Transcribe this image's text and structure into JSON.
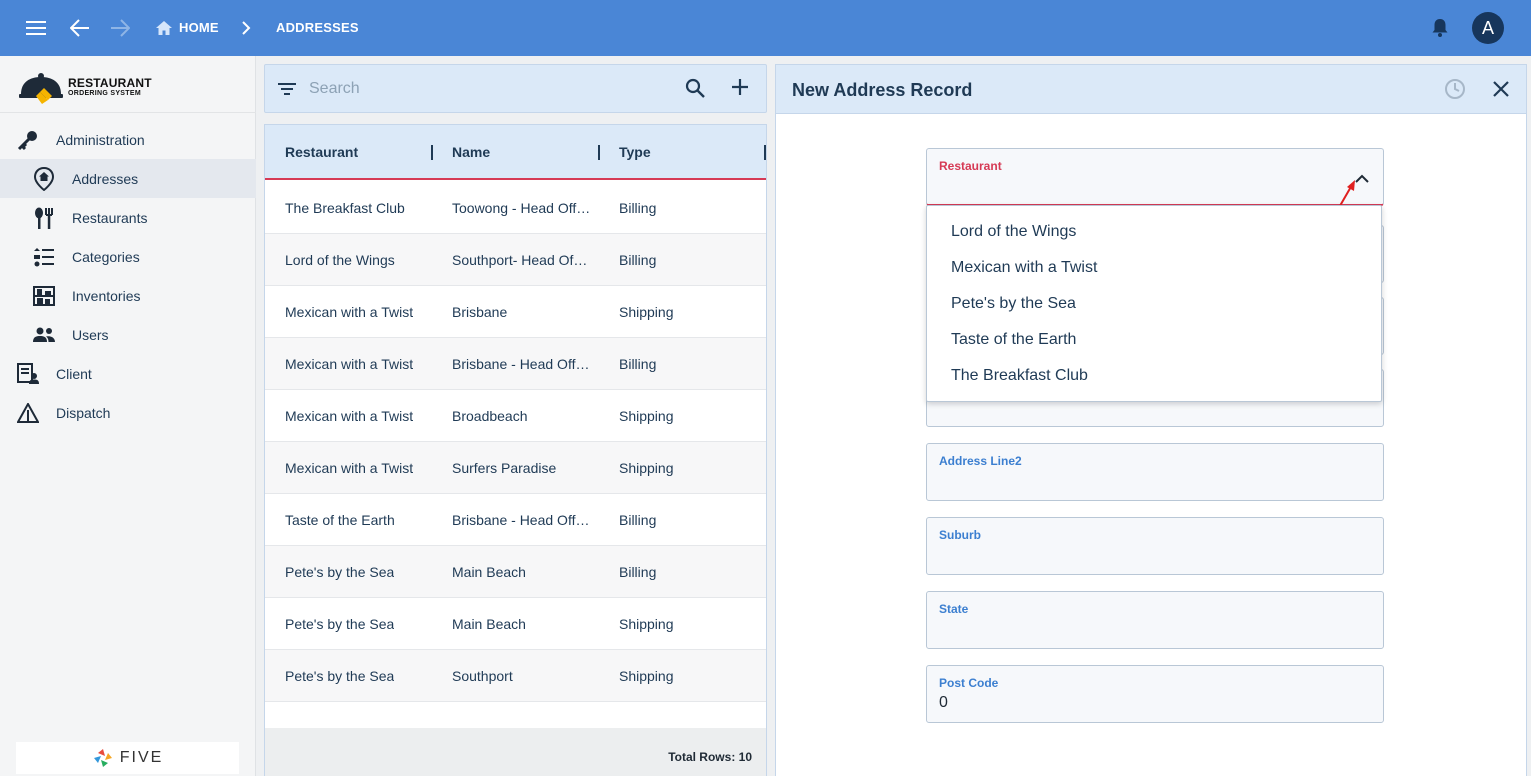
{
  "topbar": {
    "crumbs": [
      "HOME",
      "ADDRESSES"
    ],
    "avatar_letter": "A"
  },
  "logo": {
    "line1": "RESTAURANT",
    "line2": "ORDERING SYSTEM"
  },
  "sidebar": {
    "items": [
      {
        "label": "Administration",
        "icon": "key-icon"
      },
      {
        "label": "Addresses",
        "icon": "location-pin-icon"
      },
      {
        "label": "Restaurants",
        "icon": "utensils-icon"
      },
      {
        "label": "Categories",
        "icon": "list-icon"
      },
      {
        "label": "Inventories",
        "icon": "shelves-icon"
      },
      {
        "label": "Users",
        "icon": "people-icon"
      },
      {
        "label": "Client",
        "icon": "client-icon"
      },
      {
        "label": "Dispatch",
        "icon": "warning-triangle-icon"
      }
    ],
    "footer_brand": "FIVE"
  },
  "search": {
    "placeholder": "Search"
  },
  "grid": {
    "columns": [
      "Restaurant",
      "Name",
      "Type"
    ],
    "rows": [
      [
        "The Breakfast Club",
        "Toowong - Head Off…",
        "Billing"
      ],
      [
        "Lord of the Wings",
        "Southport- Head Of…",
        "Billing"
      ],
      [
        "Mexican with a Twist",
        "Brisbane",
        "Shipping"
      ],
      [
        "Mexican with a Twist",
        "Brisbane - Head Offi…",
        "Billing"
      ],
      [
        "Mexican with a Twist",
        "Broadbeach",
        "Shipping"
      ],
      [
        "Mexican with a Twist",
        "Surfers Paradise",
        "Shipping"
      ],
      [
        "Taste of the Earth",
        "Brisbane - Head Offi…",
        "Billing"
      ],
      [
        "Pete's by the Sea",
        "Main Beach",
        "Billing"
      ],
      [
        "Pete's by the Sea",
        "Main Beach",
        "Shipping"
      ],
      [
        "Pete's by the Sea",
        "Southport",
        "Shipping"
      ]
    ],
    "total_rows": "Total Rows: 10"
  },
  "form": {
    "title": "New Address Record",
    "restaurant_label": "Restaurant",
    "restaurant_options": [
      "Lord of the Wings",
      "Mexican with a Twist",
      "Pete's by the Sea",
      "Taste of the Earth",
      "The Breakfast Club"
    ],
    "address_line2_label": "Address Line2",
    "suburb_label": "Suburb",
    "state_label": "State",
    "postcode_label": "Post Code",
    "postcode_value": "0"
  },
  "colors": {
    "topbar": "#4a86d6",
    "panel_header": "#dbe9f8",
    "focus_accent": "#d63a55",
    "label_blue": "#3c7fd0",
    "text_navy": "#1f3a55"
  }
}
